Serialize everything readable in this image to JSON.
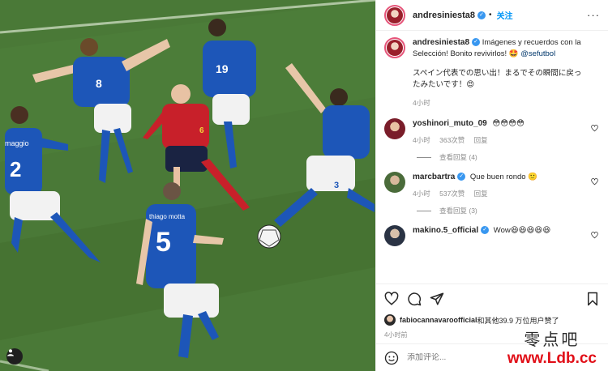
{
  "post": {
    "username": "andresiniesta8",
    "follow_label": "关注",
    "more_label": "···"
  },
  "caption": {
    "username": "andresiniesta8",
    "text": "Imágenes y recuerdos con la Selección! Bonito revivirlos! 🤩",
    "mention": "@sefutbol",
    "text_jp": "スペイン代表での思い出！まるでその瞬間に戻ったみたいです！😍",
    "time": "4小时"
  },
  "comments": [
    {
      "username": "yoshinori_muto_09",
      "text": "😳😳😳😳",
      "time": "4小时",
      "likes": "363次赞",
      "reply": "回复",
      "replies": "查看回复 (4)",
      "avatar_color": "#7a1d2a"
    },
    {
      "username": "marcbartra",
      "text": "Que buen rondo 🙂",
      "time": "4小时",
      "likes": "537次赞",
      "reply": "回复",
      "replies": "查看回复 (3)",
      "avatar_color": "#4a6b3a",
      "verified": true
    },
    {
      "username": "makino.5_official",
      "text": "Wow😆😆😆😆😆",
      "avatar_color": "#2a3344",
      "verified": true
    }
  ],
  "likes": {
    "user": "fabiocannavaroofficial",
    "rest": "和其他39.9 万位用户赞了"
  },
  "post_time": "4小时前",
  "add_comment_placeholder": "添加评论...",
  "photo_texts": {
    "player_left": "2",
    "player_left_name": "maggio",
    "player_top_left": "8",
    "player_top": "19",
    "player_right": "3",
    "player_bottom": "5",
    "player_bottom_name": "thiago motta",
    "player_red": "6"
  },
  "watermark": {
    "cn": "零点吧",
    "url": "www.Ldb.cc"
  },
  "colors": {
    "accent": "#0095f6",
    "italy_blue": "#1b4fb3",
    "spain_red": "#c8202a",
    "pitch": "#467433"
  },
  "icons": [
    "more-icon",
    "verified-icon",
    "heart-icon",
    "comment-icon",
    "share-icon",
    "bookmark-icon",
    "emoji-icon",
    "user-tag-icon"
  ]
}
